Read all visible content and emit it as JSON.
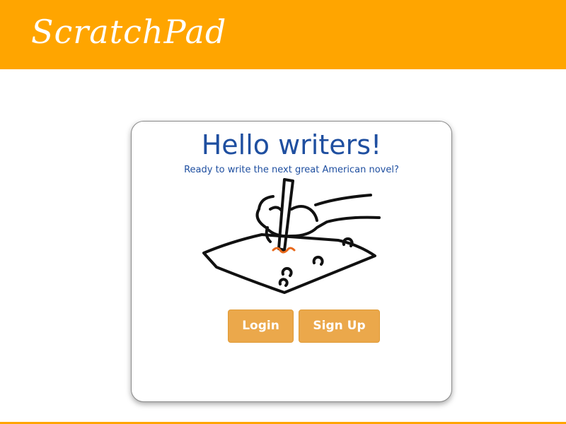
{
  "header": {
    "brand": "ScratchPad",
    "background_color": "#FFA500"
  },
  "card": {
    "title": "Hello writers!",
    "subtitle": "Ready to write the next great American novel?",
    "illustration_icon": "hand-writing-on-notepad-icon"
  },
  "buttons": {
    "login_label": "Login",
    "signup_label": "Sign Up",
    "color": "#EBA84B"
  }
}
